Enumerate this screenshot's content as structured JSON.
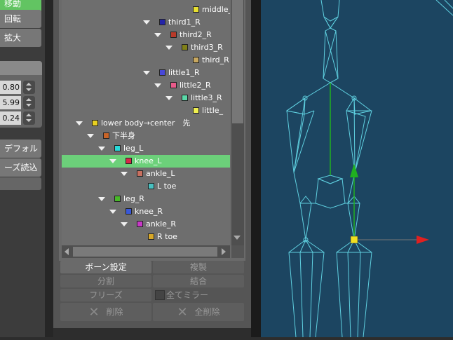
{
  "left_panel": {
    "buttons": [
      "移動",
      "回転",
      "拡大"
    ],
    "values": [
      "0.80",
      "5.99",
      "0.24"
    ],
    "actions": [
      "デフォルト",
      "ーズ読込"
    ]
  },
  "tree": {
    "rows": [
      {
        "label": "middle_",
        "color": "#e8e030"
      },
      {
        "label": "third1_R",
        "color": "#2424a8"
      },
      {
        "label": "third2_R",
        "color": "#b83a2a"
      },
      {
        "label": "third3_R",
        "color": "#808018"
      },
      {
        "label": "third_R",
        "color": "#c8a860"
      },
      {
        "label": "little1_R",
        "color": "#4848d8"
      },
      {
        "label": "little2_R",
        "color": "#e85a8a"
      },
      {
        "label": "little3_R",
        "color": "#5ad8a8"
      },
      {
        "label": "little_",
        "color": "#f0f050"
      },
      {
        "label": "lower body→center　先",
        "color": "#e8d020"
      },
      {
        "label": "下半身",
        "color": "#c86428"
      },
      {
        "label": "leg_L",
        "color": "#28d8d8"
      },
      {
        "label": "knee_L",
        "color": "#d82848"
      },
      {
        "label": "ankle_L",
        "color": "#c87060"
      },
      {
        "label": "L toe",
        "color": "#48c0c0"
      },
      {
        "label": "leg_R",
        "color": "#48b828"
      },
      {
        "label": "knee_R",
        "color": "#3858d8"
      },
      {
        "label": "ankle_R",
        "color": "#c838c8"
      },
      {
        "label": "R toe",
        "color": "#d8a828"
      }
    ]
  },
  "buttons": {
    "bone_setting": "ボーン設定",
    "duplicate": "複製",
    "split": "分割",
    "join": "結合",
    "freeze": "フリーズ",
    "mirror_all": "全てミラー",
    "delete": "削除",
    "delete_all": "全削除"
  },
  "colors": {
    "selection": "#6cd07a",
    "viewport_bg": "#1c4561",
    "bone_wire": "#5fd0e0",
    "axis_x": "#e02020",
    "axis_y": "#20b020",
    "joint": "#f0e020"
  },
  "icons": {
    "expand": "triangle-down-icon",
    "delete": "x-icon"
  }
}
